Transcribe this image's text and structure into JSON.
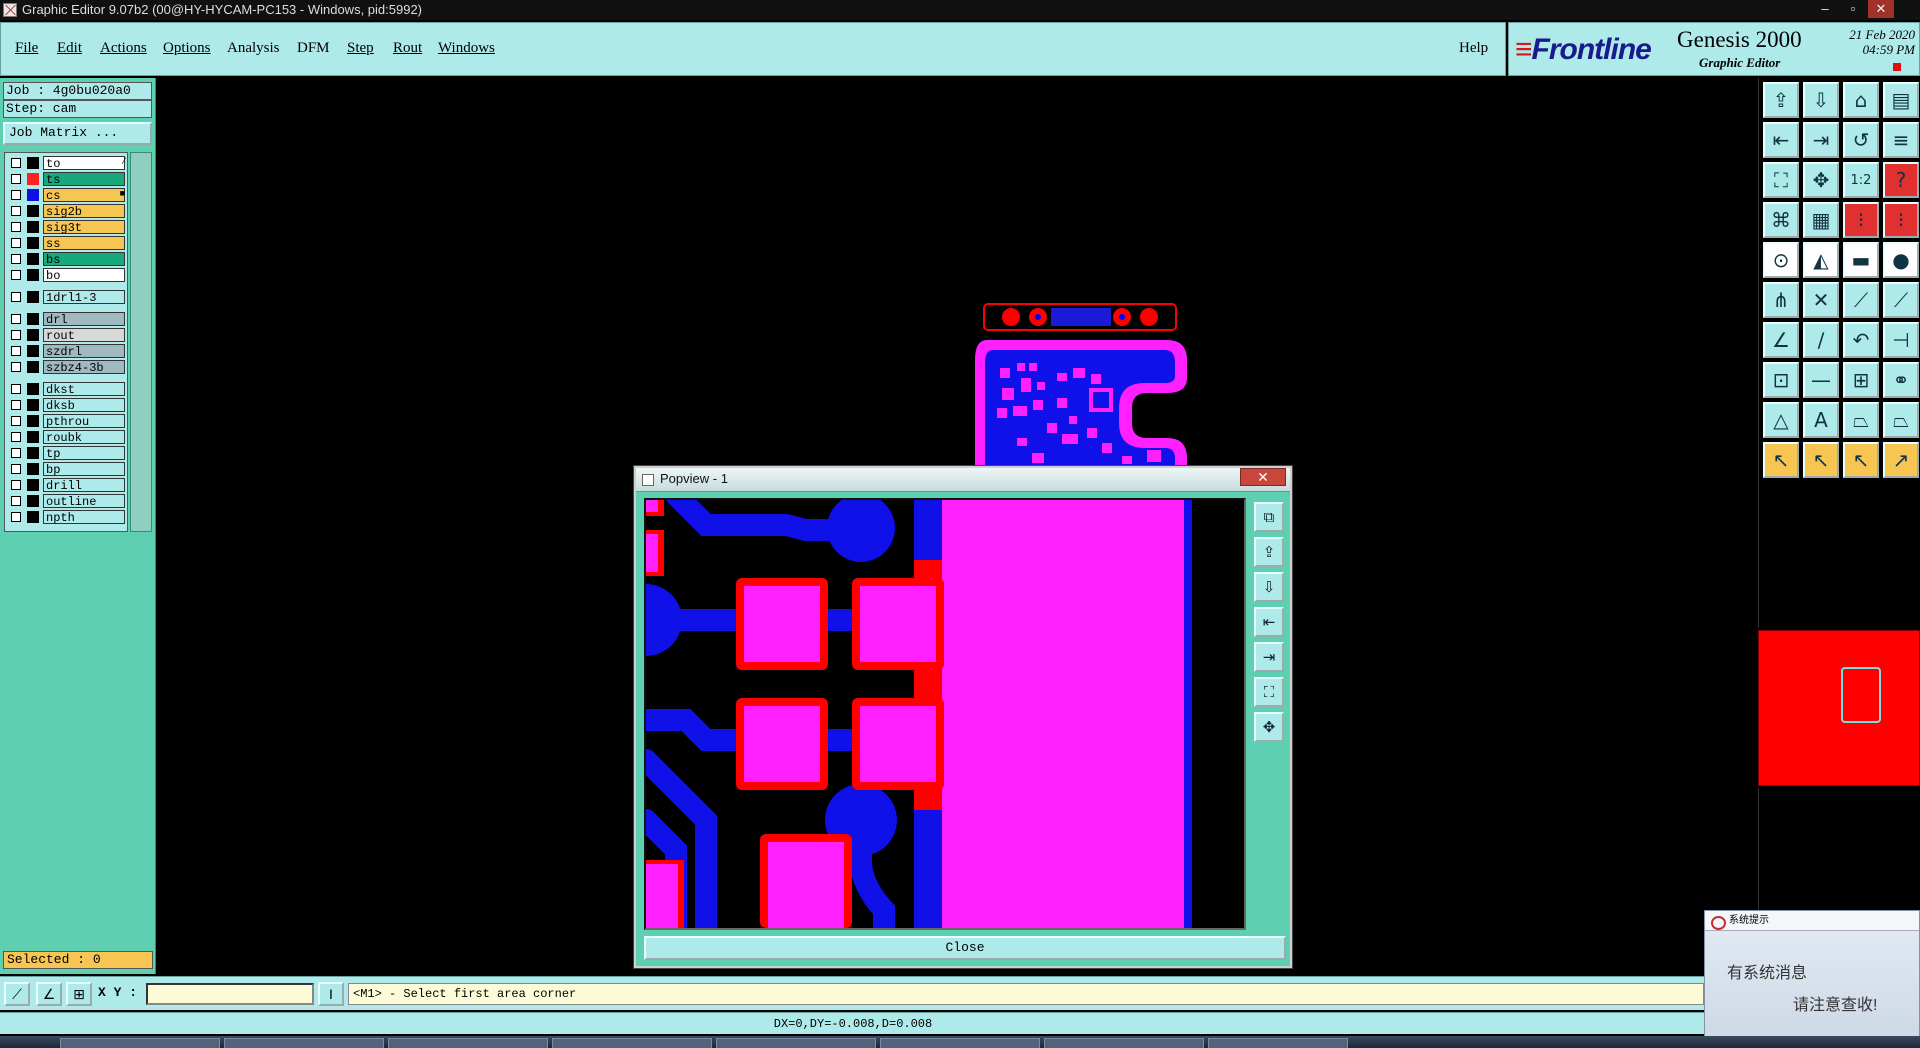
{
  "window": {
    "title": "Graphic Editor 9.07b2 (00@HY-HYCAM-PC153 - Windows, pid:5992)",
    "minimize": "–",
    "maximize": "▫",
    "close": "✕"
  },
  "menubar": {
    "items": [
      {
        "label": "File"
      },
      {
        "label": "Edit"
      },
      {
        "label": "Actions"
      },
      {
        "label": "Options"
      },
      {
        "label": "Analysis"
      },
      {
        "label": "DFM"
      },
      {
        "label": "Step"
      },
      {
        "label": "Rout"
      },
      {
        "label": "Windows"
      }
    ],
    "help": "Help"
  },
  "brand": {
    "logo": "Frontline",
    "product": "Genesis 2000",
    "subtitle": "Graphic Editor",
    "date": "21 Feb 2020",
    "time": "04:59 PM"
  },
  "left_panel": {
    "job": "Job : 4g0bu020a0",
    "step": "Step: cam",
    "job_matrix": "Job Matrix ...",
    "layers": [
      {
        "name": "to",
        "bg": "#ffffff",
        "swatch": "#000000",
        "mark": "⁄"
      },
      {
        "name": "ts",
        "bg": "#18a87a",
        "swatch": "#ff2020",
        "mark": ""
      },
      {
        "name": "cs",
        "bg": "#f7c552",
        "swatch": "#1010e0",
        "mark": "■"
      },
      {
        "name": "sig2b",
        "bg": "#f7c552",
        "swatch": "#000000",
        "mark": ""
      },
      {
        "name": "sig3t",
        "bg": "#f7c552",
        "swatch": "#000000",
        "mark": ""
      },
      {
        "name": "ss",
        "bg": "#f7c552",
        "swatch": "#000000",
        "mark": ""
      },
      {
        "name": "bs",
        "bg": "#18a87a",
        "swatch": "#000000",
        "mark": ""
      },
      {
        "name": "bo",
        "bg": "#ffffff",
        "swatch": "#000000",
        "mark": ""
      },
      {
        "name": "1drl1-3",
        "bg": "#aeeaea",
        "swatch": "#000000",
        "mark": ""
      },
      {
        "name": "drl",
        "bg": "#a0b8c0",
        "swatch": "#000000",
        "mark": ""
      },
      {
        "name": "rout",
        "bg": "#d8d8d8",
        "swatch": "#000000",
        "mark": ""
      },
      {
        "name": "szdrl",
        "bg": "#a0b8c0",
        "swatch": "#000000",
        "mark": ""
      },
      {
        "name": "szbz4-3b",
        "bg": "#a0b8c0",
        "swatch": "#000000",
        "mark": ""
      },
      {
        "name": "dkst",
        "bg": "#aeeaea",
        "swatch": "#000000",
        "mark": ""
      },
      {
        "name": "dksb",
        "bg": "#aeeaea",
        "swatch": "#000000",
        "mark": ""
      },
      {
        "name": "pthrou",
        "bg": "#aeeaea",
        "swatch": "#000000",
        "mark": ""
      },
      {
        "name": "roubk",
        "bg": "#aeeaea",
        "swatch": "#000000",
        "mark": ""
      },
      {
        "name": "tp",
        "bg": "#aeeaea",
        "swatch": "#000000",
        "mark": ""
      },
      {
        "name": "bp",
        "bg": "#aeeaea",
        "swatch": "#000000",
        "mark": ""
      },
      {
        "name": "drill",
        "bg": "#aeeaea",
        "swatch": "#000000",
        "mark": ""
      },
      {
        "name": "outline",
        "bg": "#aeeaea",
        "swatch": "#000000",
        "mark": ""
      },
      {
        "name": "npth",
        "bg": "#aeeaea",
        "swatch": "#000000",
        "mark": ""
      }
    ],
    "selected": "Selected : 0"
  },
  "toolbox": {
    "tools": [
      {
        "icon": "⇪",
        "bg": "#aeeaea"
      },
      {
        "icon": "⇩",
        "bg": "#aeeaea"
      },
      {
        "icon": "⌂",
        "bg": "#aeeaea"
      },
      {
        "icon": "▤",
        "bg": "#aeeaea"
      },
      {
        "icon": "⇤",
        "bg": "#aeeaea"
      },
      {
        "icon": "⇥",
        "bg": "#aeeaea"
      },
      {
        "icon": "↺",
        "bg": "#aeeaea"
      },
      {
        "icon": "≡",
        "bg": "#aeeaea"
      },
      {
        "icon": "⛶",
        "bg": "#aeeaea"
      },
      {
        "icon": "✥",
        "bg": "#aeeaea"
      },
      {
        "icon": "1:2",
        "bg": "#aeeaea"
      },
      {
        "icon": "?",
        "bg": "#e03030"
      },
      {
        "icon": "⌘",
        "bg": "#aeeaea"
      },
      {
        "icon": "▦",
        "bg": "#aeeaea"
      },
      {
        "icon": "⁝",
        "bg": "#e03030"
      },
      {
        "icon": "⁝",
        "bg": "#e03030"
      },
      {
        "icon": "⊙",
        "bg": "#ffffff"
      },
      {
        "icon": "◭",
        "bg": "#ffffff"
      },
      {
        "icon": "▬",
        "bg": "#ffffff"
      },
      {
        "icon": "●",
        "bg": "#ffffff"
      },
      {
        "icon": "⋔",
        "bg": "#aeeaea"
      },
      {
        "icon": "✕",
        "bg": "#aeeaea"
      },
      {
        "icon": "⟋",
        "bg": "#aeeaea"
      },
      {
        "icon": "⟋",
        "bg": "#aeeaea"
      },
      {
        "icon": "∠",
        "bg": "#aeeaea"
      },
      {
        "icon": "∕",
        "bg": "#aeeaea"
      },
      {
        "icon": "↶",
        "bg": "#aeeaea"
      },
      {
        "icon": "⊣",
        "bg": "#aeeaea"
      },
      {
        "icon": "⊡",
        "bg": "#aeeaea"
      },
      {
        "icon": "—",
        "bg": "#aeeaea"
      },
      {
        "icon": "⊞",
        "bg": "#aeeaea"
      },
      {
        "icon": "⚭",
        "bg": "#aeeaea"
      },
      {
        "icon": "△",
        "bg": "#aeeaea"
      },
      {
        "icon": "A",
        "bg": "#aeeaea"
      },
      {
        "icon": "⏢",
        "bg": "#aeeaea"
      },
      {
        "icon": "⏢",
        "bg": "#aeeaea"
      },
      {
        "icon": "↖",
        "bg": "#f7c552"
      },
      {
        "icon": "↖",
        "bg": "#f7c552"
      },
      {
        "icon": "↖",
        "bg": "#f7c552"
      },
      {
        "icon": "↗",
        "bg": "#f7c552"
      }
    ]
  },
  "popview": {
    "title": "Popview - 1",
    "close_x": "✕",
    "close_button": "Close",
    "tools": [
      "⧉",
      "⇪",
      "⇩",
      "⇤",
      "⇥",
      "⛶",
      "✥"
    ]
  },
  "command": {
    "xy_label": "X Y :",
    "xy_value": "",
    "prompt": "<M1> - Select first area corner",
    "buttons": [
      "⟋",
      "∠",
      "⊞"
    ],
    "i_button": "I"
  },
  "status": "DX=0,DY=-0.008,D=0.008",
  "notification": {
    "header": "系统提示",
    "line1": "有系统消息",
    "line2": "请注意查收!"
  },
  "colors": {
    "panel_cyan": "#aeeaea",
    "panel_green": "#5ecfb0",
    "copper_blue": "#1010e8",
    "pad_magenta": "#ff20ff",
    "pad_red": "#ff0000"
  }
}
